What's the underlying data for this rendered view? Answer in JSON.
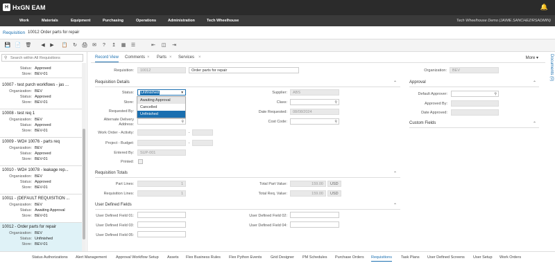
{
  "app": {
    "logo": "HxGN EAM",
    "user": "Tech Wheelhouse Demo (JAIME.SANCHEZ/RSADMIN)"
  },
  "menu": [
    "Work",
    "Materials",
    "Equipment",
    "Purchasing",
    "Operations",
    "Administration",
    "Tech Wheelhouse"
  ],
  "header": {
    "entity": "Requisition",
    "record": "10012  Order parts for repair"
  },
  "search": {
    "placeholder": "Search within All Requisitions"
  },
  "records": [
    {
      "title": "",
      "org": "",
      "status": "Approved",
      "store": "BEV-01"
    },
    {
      "title": "10007 - test purch workflows - jas ...",
      "org": "BEV",
      "status": "Approved",
      "store": "BEV-01"
    },
    {
      "title": "10008 - test req 1",
      "org": "BEV",
      "status": "Approved",
      "store": "BEV-01"
    },
    {
      "title": "10009 - WO# 10076 - parts req",
      "org": "BEV",
      "status": "Approved",
      "store": "BEV-01"
    },
    {
      "title": "10010 - WO# 10078 - leakage rep...",
      "org": "BEV",
      "status": "Approved",
      "store": "BEV-01"
    },
    {
      "title": "10011 - (DEFAULT REQUISITION ...",
      "org": "BEV",
      "status": "Awaiting Approval",
      "store": "BEV-01"
    },
    {
      "title": "10012 - Order parts for repair",
      "org": "BEV",
      "status": "Unfinished",
      "store": "BEV-01"
    }
  ],
  "labels": {
    "org": "Organization:",
    "status": "Status:",
    "store": "Store:"
  },
  "tabs": [
    "Record View",
    "Comments",
    "Parts",
    "Services"
  ],
  "more": "More",
  "documents": "Documents (0)",
  "form": {
    "requisition_label": "Requisition:",
    "requisition_value": "10012",
    "description": "Order parts for repair",
    "org_label": "Organization:",
    "org_value": "BEV",
    "details_title": "Requisition Details",
    "status_label": "Status:",
    "status_value": "Unfinished",
    "store_label": "Store:",
    "requested_by_label": "Requested By:",
    "alt_delivery_label1": "Alternate Delivery",
    "alt_delivery_label2": "Address:",
    "work_order_label": "Work Order - Activity:",
    "project_label": "Project - Budget:",
    "entered_by_label": "Entered By:",
    "entered_by_value": "SUP-001",
    "printed_label": "Printed:",
    "supplier_label": "Supplier:",
    "supplier_value": "ABS",
    "class_label": "Class:",
    "date_requested_label": "Date Requested:",
    "date_requested_value": "08/08/2024",
    "cost_code_label": "Cost Code:",
    "dash": "-",
    "status_options": [
      "Awaiting Approval",
      "Cancelled",
      "Unfinished"
    ],
    "approval_title": "Approval",
    "default_approver_label": "Default Approver:",
    "approved_by_label": "Approved By:",
    "date_approved_label": "Date Approved:",
    "custom_title": "Custom Fields",
    "totals_title": "Requisition Totals",
    "part_lines_label": "Part Lines:",
    "part_lines_value": "1",
    "req_lines_label": "Requisition Lines:",
    "req_lines_value": "1",
    "total_part_label": "Total Part Value:",
    "total_part_value": "159.00",
    "total_req_label": "Total Req. Value:",
    "total_req_value": "159.00",
    "currency": "USD",
    "udf_title": "User Defined Fields",
    "udf": [
      "User Defined Field 01:",
      "User Defined Field 02:",
      "User Defined Field 03:",
      "User Defined Field 04:",
      "User Defined Field 05:"
    ]
  },
  "bottom_tabs": [
    "Status Authorizations",
    "Alert Management",
    "Approval Workflow Setup",
    "Assets",
    "Flex Business Rules",
    "Flex Python Events",
    "Grid Designer",
    "PM Schedules",
    "Purchase Orders",
    "Requisitions",
    "Task Plans",
    "User Defined Screens",
    "User Setup",
    "Work Orders"
  ]
}
